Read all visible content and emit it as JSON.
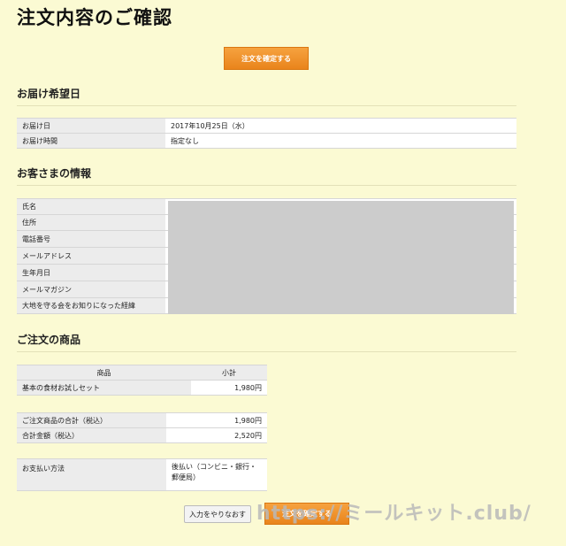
{
  "page": {
    "title": "注文内容のご確認",
    "confirm_button": "注文を確定する"
  },
  "delivery": {
    "heading": "お届け希望日",
    "rows": [
      {
        "label": "お届け日",
        "value": "2017年10月25日（水）"
      },
      {
        "label": "お届け時間",
        "value": "指定なし"
      }
    ]
  },
  "customer": {
    "heading": "お客さまの情報",
    "rows": [
      {
        "label": "氏名"
      },
      {
        "label": "住所"
      },
      {
        "label": "電話番号"
      },
      {
        "label": "メールアドレス"
      },
      {
        "label": "生年月日"
      },
      {
        "label": "メールマガジン"
      },
      {
        "label": "大地を守る会をお知りになった経緯"
      }
    ]
  },
  "order": {
    "heading": "ご注文の商品",
    "columns": [
      "商品",
      "小計"
    ],
    "items": [
      {
        "name": "基本の食材お試しセット",
        "subtotal": "1,980円"
      }
    ],
    "totals": [
      {
        "label": "ご注文商品の合計（税込）",
        "value": "1,980円"
      },
      {
        "label": "合計金額（税込）",
        "value": "2,520円"
      }
    ],
    "payment": {
      "label": "お支払い方法",
      "value_line1": "後払い（コンビニ・銀行・",
      "value_line2": "郵便局）"
    }
  },
  "actions": {
    "redo_button": "入力をやりなおす",
    "confirm_button": "注文を確定する"
  },
  "watermark": "https://ミールキット.club/"
}
